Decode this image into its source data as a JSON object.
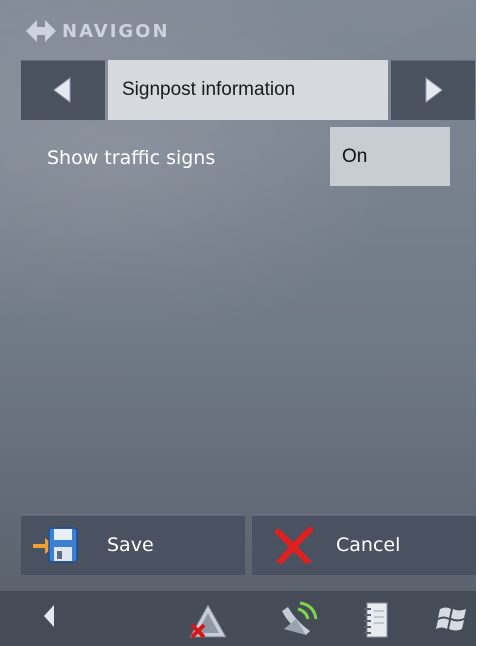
{
  "brand": {
    "name": "NAVIGON",
    "icon": "navigon-logo-icon"
  },
  "header": {
    "title": "Signpost information",
    "prev_icon": "triangle-left-icon",
    "next_icon": "triangle-right-icon"
  },
  "settings": [
    {
      "label": "Show traffic signs",
      "value": "On"
    }
  ],
  "actions": {
    "save_label": "Save",
    "save_icon": "floppy-disk-icon",
    "cancel_label": "Cancel",
    "cancel_icon": "red-x-icon"
  },
  "taskbar": {
    "icons": [
      "back-arrow-icon",
      "warning-muted-icon",
      "gps-satellite-icon",
      "notebook-icon",
      "windows-flag-icon"
    ]
  },
  "colors": {
    "accent_title_bg": "#d6d9de",
    "button_bg": "#4a5260",
    "cancel_red": "#e01f1f",
    "brand_text": "#ccd3de"
  }
}
